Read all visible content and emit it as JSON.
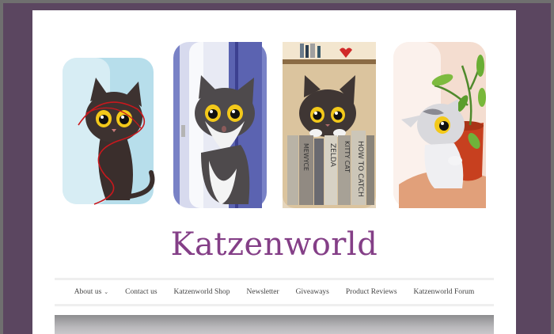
{
  "site": {
    "title": "Katzenworld"
  },
  "hero": {
    "panels": [
      {
        "name": "cat-with-yarn",
        "bg": "#a8d8e6"
      },
      {
        "name": "cat-in-doorway",
        "bg": "#7b84c8"
      },
      {
        "name": "cat-on-bookshelf",
        "bg": "#d9c7a8"
      },
      {
        "name": "cat-with-plant",
        "bg": "#f0d7c8"
      }
    ],
    "book_spines": [
      "HOW TO CATCH",
      "KITTY CAT",
      "ZELDA",
      "MEWYCE"
    ]
  },
  "nav": {
    "items": [
      {
        "label": "About us",
        "has_submenu": true
      },
      {
        "label": "Contact us"
      },
      {
        "label": "Katzenworld Shop"
      },
      {
        "label": "Newsletter"
      },
      {
        "label": "Giveaways"
      },
      {
        "label": "Product Reviews"
      },
      {
        "label": "Katzenworld Forum"
      }
    ]
  },
  "colors": {
    "background": "#5b4660",
    "title": "#843f87"
  }
}
